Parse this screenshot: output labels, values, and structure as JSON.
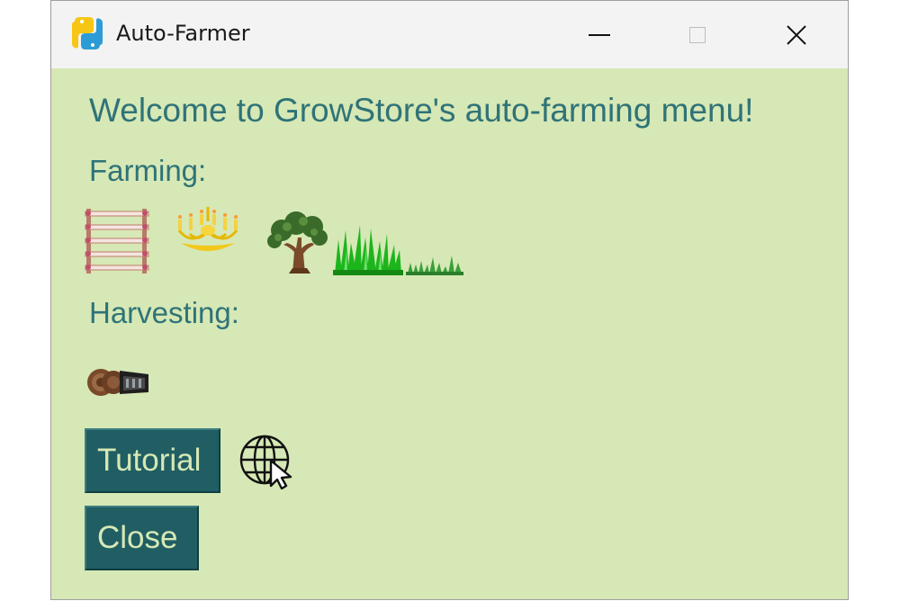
{
  "window": {
    "title": "Auto-Farmer",
    "app_icon": "python-icon",
    "controls": {
      "minimize_icon": "minimize-icon",
      "maximize_icon": "maximize-icon",
      "close_icon": "close-icon"
    }
  },
  "content": {
    "welcome_text": "Welcome to GrowStore's auto-farming menu!",
    "farming_label": "Farming:",
    "farming_items": [
      {
        "icon": "fence-icon"
      },
      {
        "icon": "chandelier-icon"
      },
      {
        "icon": "tree-icon"
      },
      {
        "icon": "tall-grass-icon"
      },
      {
        "icon": "short-grass-icon"
      }
    ],
    "harvesting_label": "Harvesting:",
    "harvesting_items": [
      {
        "icon": "harvester-icon"
      }
    ],
    "tutorial_button": "Tutorial",
    "web_icon": "globe-cursor-icon",
    "close_button": "Close"
  },
  "colors": {
    "background": "#d6e8b5",
    "text": "#2f7378",
    "button_bg": "#205e63",
    "button_text": "#d6e8b5",
    "titlebar": "#f3f3f3"
  }
}
